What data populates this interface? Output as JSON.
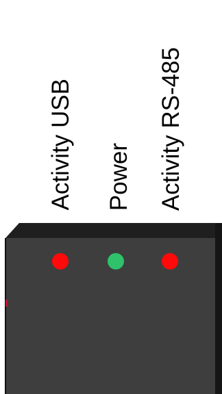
{
  "labels": {
    "activity_usb": "Activity USB",
    "power": "Power",
    "activity_rs485": "Activity RS-485"
  },
  "leds": [
    {
      "name": "activity-usb-led",
      "color": "#ff0a0a",
      "state": "on"
    },
    {
      "name": "power-led",
      "color": "#2fc26b",
      "state": "on"
    },
    {
      "name": "activity-rs485-led",
      "color": "#ff0a0a",
      "state": "on"
    }
  ],
  "colors": {
    "housing_face": "#3e3e3e",
    "housing_top": "#1f1f1f",
    "housing_side": "#151515",
    "housing_edge_accent": "#c8102e",
    "background": "#ffffff",
    "text": "#000000"
  }
}
